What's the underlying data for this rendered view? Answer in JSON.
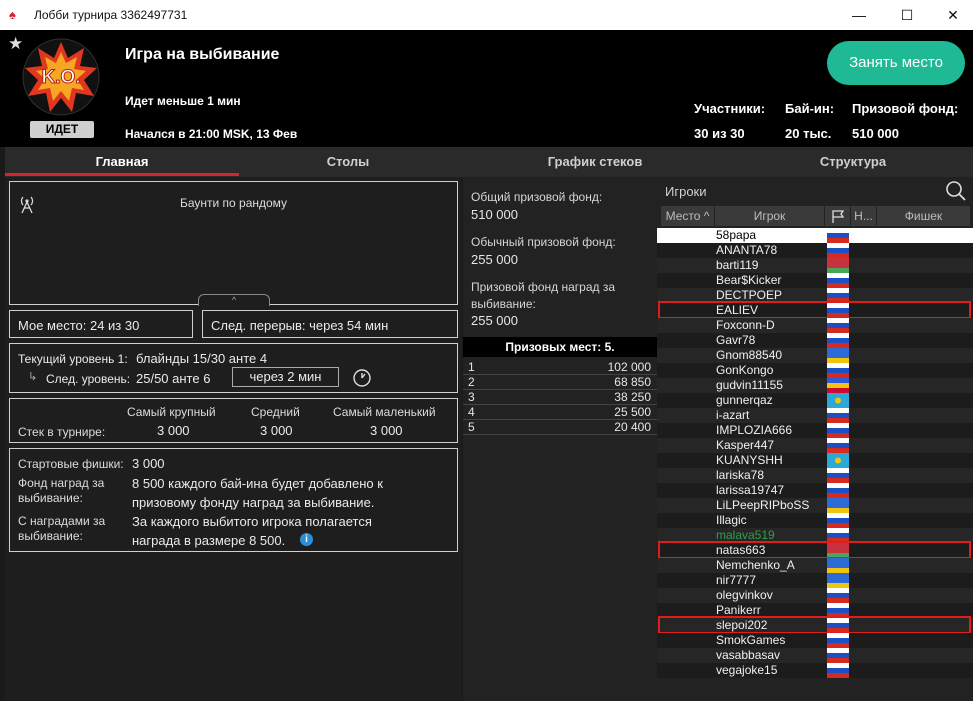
{
  "window": {
    "title": "Лобби турнира 3362497731"
  },
  "header": {
    "status_badge": "ИДЕТ",
    "logo_text": "K.O.",
    "title": "Игра на выбивание",
    "status": "Идет меньше 1 мин",
    "started": "Начался в 21:00 MSK, 13 Фев",
    "seat_button": "Занять место",
    "stats": [
      {
        "label": "Участники:",
        "value": "30 из 30"
      },
      {
        "label": "Бай-ин:",
        "value": "20 тыс."
      },
      {
        "label": "Призовой фонд:",
        "value": "510 000"
      }
    ]
  },
  "tabs": [
    "Главная",
    "Столы",
    "График стеков",
    "Структура"
  ],
  "main": {
    "bounty_title": "Баунти по рандому",
    "my_place": "Мое место: 24 из 30",
    "next_break": "След. перерыв: через 54 мин",
    "current_level_label": "Текущий уровень 1:",
    "current_level_value": "блайнды 15/30 анте  4",
    "next_level_label": "След. уровень:",
    "next_level_value": "25/50 анте  6",
    "next_level_time": "через 2 мин",
    "stack_headers": [
      "Самый крупный",
      "Средний",
      "Самый маленький"
    ],
    "stack_label": "Стек в турнире:",
    "stack_values": [
      "3 000",
      "3 000",
      "3 000"
    ],
    "info": [
      {
        "label": "Стартовые фишки:",
        "value": "3 000"
      },
      {
        "label": "Фонд наград за выбивание:",
        "value": "8 500 каждого бай-ина будет добавлено к призовому фонду наград за выбивание."
      },
      {
        "label": "С наградами за выбивание:",
        "value": "За каждого выбитого игрока полагается награда в размере 8 500."
      }
    ]
  },
  "prize": {
    "total_label": "Общий призовой фонд:",
    "total_value": "510 000",
    "regular_label": "Обычный призовой фонд:",
    "regular_value": "255 000",
    "bounty_label": "Призовой фонд наград за выбивание:",
    "bounty_value": "255 000",
    "places_header": "Призовых мест: 5.",
    "places": [
      {
        "place": "1",
        "amount": "102 000"
      },
      {
        "place": "2",
        "amount": "68 850"
      },
      {
        "place": "3",
        "amount": "38 250"
      },
      {
        "place": "4",
        "amount": "25 500"
      },
      {
        "place": "5",
        "amount": "20 400"
      }
    ]
  },
  "players": {
    "search_placeholder": "Игроки",
    "columns": [
      "Место",
      "Игрок",
      "Н...",
      "Фишек"
    ],
    "list": [
      {
        "name": "58papa",
        "flag": "ru",
        "selected": true
      },
      {
        "name": "ANANTA78",
        "flag": "ru"
      },
      {
        "name": "barti119",
        "flag": "by"
      },
      {
        "name": "Bear$Kicker",
        "flag": "ru"
      },
      {
        "name": "DECTPOEP",
        "flag": "ru"
      },
      {
        "name": "EALIEV",
        "flag": "ru",
        "highlight": true
      },
      {
        "name": "Foxconn-D",
        "flag": "ru"
      },
      {
        "name": "Gavr78",
        "flag": "ru"
      },
      {
        "name": "Gnom88540",
        "flag": "ua"
      },
      {
        "name": "GonKongo",
        "flag": "ru"
      },
      {
        "name": "gudvin11155",
        "flag": "md"
      },
      {
        "name": "gunnerqaz",
        "flag": "kz"
      },
      {
        "name": "i-azart",
        "flag": "ru"
      },
      {
        "name": "IMPLOZIA666",
        "flag": "ru"
      },
      {
        "name": "Kasper447",
        "flag": "ru"
      },
      {
        "name": "KUANYSHH",
        "flag": "kz"
      },
      {
        "name": "lariska78",
        "flag": "ru"
      },
      {
        "name": "larissa19747",
        "flag": "ru"
      },
      {
        "name": "LiLPeepRIPboSS",
        "flag": "ua"
      },
      {
        "name": "Illagic",
        "flag": "ru"
      },
      {
        "name": "malava519",
        "flag": "ru",
        "green": true
      },
      {
        "name": "natas663",
        "flag": "by",
        "highlight": true
      },
      {
        "name": "Nemchenko_A",
        "flag": "ua"
      },
      {
        "name": "nir7777",
        "flag": "ua"
      },
      {
        "name": "olegvinkov",
        "flag": "ru"
      },
      {
        "name": "Panikerr",
        "flag": "ru"
      },
      {
        "name": "slepoi202",
        "flag": "ru",
        "highlight": true
      },
      {
        "name": "SmokGames",
        "flag": "ru"
      },
      {
        "name": "vasabbasav",
        "flag": "ru"
      },
      {
        "name": "vegajoke15",
        "flag": "ru"
      }
    ]
  },
  "colors": {
    "accent": "#1fb996",
    "tab_underline": "#d8232a",
    "highlight": "#e01c1c"
  }
}
